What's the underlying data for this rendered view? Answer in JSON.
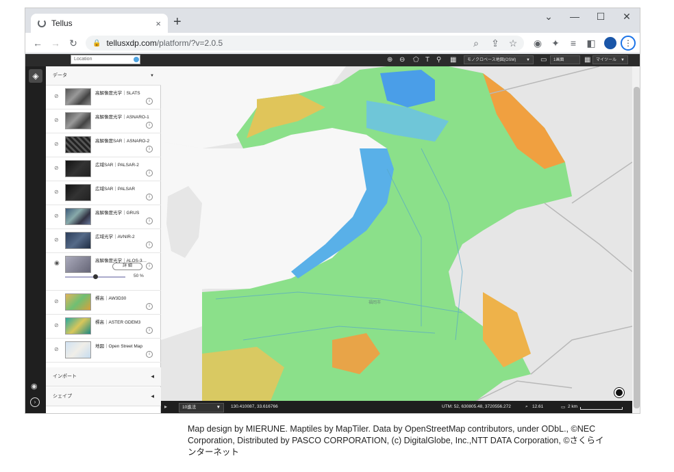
{
  "browser": {
    "tab_title": "Tellus",
    "tab_close": "×",
    "new_tab": "+",
    "url_host": "tellusxdp.com",
    "url_path": "/platform/?v=2.0.5",
    "win_minimize": "—",
    "win_maximize": "☐",
    "win_close": "✕",
    "win_tabsearch": "⌄",
    "back": "←",
    "forward": "→",
    "reload": "↻",
    "menu": "⋮"
  },
  "appbar": {
    "location_placeholder": "Location",
    "basemap_select": "モノクロベース地図(OSM)",
    "screen_select": "1画面",
    "mytool_select": "マイツール"
  },
  "sidebar": {
    "data_section": "データ",
    "import_section": "インポート",
    "shape_section": "シェイプ",
    "layers": [
      {
        "name": "高解像度光学｜SLATS",
        "thumb": "th-gray"
      },
      {
        "name": "高解像度光学｜ASNARO-1",
        "thumb": "th-gray"
      },
      {
        "name": "高解像度SAR｜ASNARO-2",
        "thumb": "th-sar"
      },
      {
        "name": "広域SAR｜PALSAR-2",
        "thumb": "th-dark"
      },
      {
        "name": "広域SAR｜PALSAR",
        "thumb": "th-dark"
      },
      {
        "name": "高解像度光学｜GRUS",
        "thumb": "th-grus"
      },
      {
        "name": "広域光学｜AVNIR-2",
        "thumb": "th-avnir"
      },
      {
        "name": "高解像度光学｜ALOS-3…",
        "thumb": "th-alos"
      },
      {
        "name": "標高｜AW3D30",
        "thumb": "th-aw3d"
      },
      {
        "name": "標高｜ASTER GDEM3",
        "thumb": "th-aster"
      },
      {
        "name": "地図｜Open Street Map",
        "thumb": "th-osm"
      }
    ],
    "detail_button": "詳 細",
    "opacity": 0.5,
    "opacity_label": "50 %"
  },
  "statusbar": {
    "coord_system": "10進法",
    "lonlat": "130.410087, 33.616766",
    "utm": "UTM: 52, 630805.48, 3720556.272",
    "zoom": "12.61",
    "scale": "2 km"
  },
  "caption": "Map design by MIERUNE. Maptiles by MapTiler. Data by OpenStreetMap contributors, under ODbL., ©NEC Corporation, Distributed by PASCO CORPORATION, (c) DigitalGlobe, Inc.,NTT DATA Corporation, ©さくらインターネット",
  "colors": {
    "water": "#4a9ee8",
    "land_green": "#7ed87a",
    "elev_high": "#e8a040",
    "rail_dark": "#1f1f1f"
  }
}
